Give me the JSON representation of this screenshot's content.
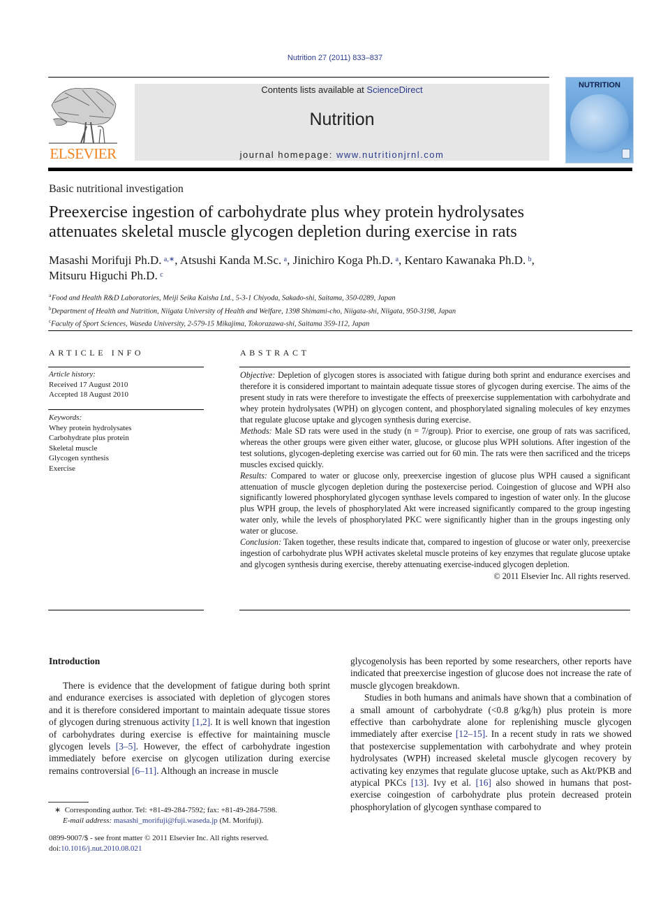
{
  "journal_citation": "Nutrition 27 (2011) 833–837",
  "header": {
    "contents_prefix": "Contents lists available at ",
    "contents_link": "ScienceDirect",
    "journal_name": "Nutrition",
    "homepage_prefix": "journal homepage: ",
    "homepage_link": "www.nutritionjrnl.com",
    "publisher_logo": "ELSEVIER",
    "cover_title": "NUTRITION",
    "colors": {
      "publisher_orange": "#f0821e",
      "link_blue": "#2a3a8c",
      "banner_gray": "#e6e6e6"
    }
  },
  "article": {
    "section_type": "Basic nutritional investigation",
    "title_line1": "Preexercise ingestion of carbohydrate plus whey protein hydrolysates",
    "title_line2": "attenuates skeletal muscle glycogen depletion during exercise in rats",
    "authors": [
      {
        "name": "Masashi Morifuji Ph.D.",
        "sup": "a,∗",
        "sep": ", "
      },
      {
        "name": "Atsushi Kanda M.Sc.",
        "sup": "a",
        "sep": ", "
      },
      {
        "name": "Jinichiro Koga Ph.D.",
        "sup": "a",
        "sep": ", "
      },
      {
        "name": "Kentaro Kawanaka Ph.D.",
        "sup": "b",
        "sep": ","
      },
      {
        "name": "Mitsuru Higuchi Ph.D.",
        "sup": "c",
        "sep": ""
      }
    ],
    "affiliations": [
      {
        "key": "a",
        "text": "Food and Health R&D Laboratories, Meiji Seika Kaisha Ltd., 5-3-1 Chiyoda, Sakado-shi, Saitama, 350-0289, Japan"
      },
      {
        "key": "b",
        "text": "Department of Health and Nutrition, Niigata University of Health and Welfare, 1398 Shimami-cho, Niigata-shi, Niigata, 950-3198, Japan"
      },
      {
        "key": "c",
        "text": "Faculty of Sport Sciences, Waseda University, 2-579-15 Mikajima, Tokorazawa-shi, Saitama 359-112, Japan"
      }
    ]
  },
  "article_info": {
    "heading": "ARTICLE INFO",
    "history_label": "Article history:",
    "received": "Received 17 August 2010",
    "accepted": "Accepted 18 August 2010",
    "keywords_label": "Keywords:",
    "keywords": [
      "Whey protein hydrolysates",
      "Carbohydrate plus protein",
      "Skeletal muscle",
      "Glycogen synthesis",
      "Exercise"
    ]
  },
  "abstract": {
    "heading": "ABSTRACT",
    "sections": [
      {
        "label": "Objective:",
        "text": " Depletion of glycogen stores is associated with fatigue during both sprint and endurance exercises and therefore it is considered important to maintain adequate tissue stores of glycogen during exercise. The aims of the present study in rats were therefore to investigate the effects of preexercise supplementation with carbohydrate and whey protein hydrolysates (WPH) on glycogen content, and phosphorylated signaling molecules of key enzymes that regulate glucose uptake and glycogen synthesis during exercise."
      },
      {
        "label": "Methods:",
        "text": " Male SD rats were used in the study (n = 7/group). Prior to exercise, one group of rats was sacrificed, whereas the other groups were given either water, glucose, or glucose plus WPH solutions. After ingestion of the test solutions, glycogen-depleting exercise was carried out for 60 min. The rats were then sacrificed and the triceps muscles excised quickly."
      },
      {
        "label": "Results:",
        "text": " Compared to water or glucose only, preexercise ingestion of glucose plus WPH caused a significant attenuation of muscle glycogen depletion during the postexercise period. Coingestion of glucose and WPH also significantly lowered phosphorylated glycogen synthase levels compared to ingestion of water only. In the glucose plus WPH group, the levels of phosphorylated Akt were increased significantly compared to the group ingesting water only, while the levels of phos­phorylated PKC were significantly higher than in the groups ingesting only water or glucose."
      },
      {
        "label": "Conclusion:",
        "text": " Taken together, these results indicate that, compared to ingestion of glucose or water only, preexercise ingestion of carbohydrate plus WPH activates skeletal muscle proteins of key enzymes that regulate glucose uptake and glycogen synthesis during exercise, thereby attenuating exercise-induced glycogen depletion."
      }
    ],
    "copyright": "© 2011 Elsevier Inc. All rights reserved."
  },
  "introduction": {
    "heading": "Introduction",
    "left_col": [
      {
        "t": "There is evidence that the development of fatigue during both sprint and endurance exercises is associated with depletion of glycogen stores and it is therefore considered important to maintain adequate tissue stores of glycogen during strenuous activity "
      },
      {
        "ref": "[1,2]"
      },
      {
        "t": ". It is well known that ingestion of carbohydrates during exercise is effective for maintaining muscle glycogen levels "
      },
      {
        "ref": "[3–5]"
      },
      {
        "t": ". However, the effect of carbohydrate ingestion immediately before exercise on glycogen utilization during exercise remains controversial "
      },
      {
        "ref": "[6–11]"
      },
      {
        "t": ". Although an increase in muscle"
      }
    ],
    "right_p1": "glycogenolysis has been reported by some researchers, other reports have indicated that preexercise ingestion of glucose does not increase the rate of muscle glycogen breakdown.",
    "right_p2": [
      {
        "t": "Studies in both humans and animals have shown that a combination of a small amount of carbohydrate (<0.8 g/kg/h) plus protein is more effective than carbohydrate alone for replen­ishing muscle glycogen immediately after exercise "
      },
      {
        "ref": "[12–15]"
      },
      {
        "t": ". In a recent study in rats we showed that postexercise supplementa­tion with carbohydrate and whey protein hydrolysates (WPH) increased skeletal muscle glycogen recovery by activating key enzymes that regulate glucose uptake, such as Akt/PKB and atyp­ical PKCs "
      },
      {
        "ref": "[13]"
      },
      {
        "t": ". Ivy et al. "
      },
      {
        "ref": "[16]"
      },
      {
        "t": " also showed in humans that post­exercise coingestion of carbohydrate plus protein decreased protein phosphorylation of glycogen synthase compared to"
      }
    ]
  },
  "footnotes": {
    "corresponding_marker": "∗",
    "corresponding": "Corresponding author. Tel: +81-49-284-7592; fax: +81-49-284-7598.",
    "email_label": "E-mail address:",
    "email": "masashi_morifuji@fuji.waseda.jp",
    "email_suffix": " (M. Morifuji).",
    "front_matter": "0899-9007/$ - see front matter © 2011 Elsevier Inc. All rights reserved.",
    "doi_label": "doi:",
    "doi": "10.1016/j.nut.2010.08.021"
  }
}
